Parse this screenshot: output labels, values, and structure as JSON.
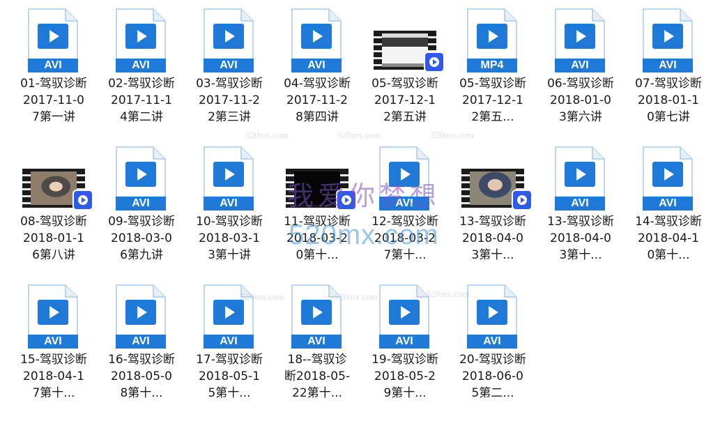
{
  "files": [
    {
      "name": "01-驾驭诊断2017-11-07第一讲",
      "type": "doc",
      "ext": "AVI"
    },
    {
      "name": "02-驾驭诊断2017-11-14第二讲",
      "type": "doc",
      "ext": "AVI"
    },
    {
      "name": "03-驾驭诊断2017-11-22第三讲",
      "type": "doc",
      "ext": "AVI"
    },
    {
      "name": "04-驾驭诊断2017-11-28第四讲",
      "type": "doc",
      "ext": "AVI"
    },
    {
      "name": "05-驾驭诊断2017-12-12第五讲",
      "type": "thumb",
      "thumb": "screen"
    },
    {
      "name": "05-驾驭诊断2017-12-12第五...",
      "type": "doc",
      "ext": "MP4"
    },
    {
      "name": "06-驾驭诊断2018-01-03第六讲",
      "type": "doc",
      "ext": "AVI"
    },
    {
      "name": "07-驾驭诊断2018-01-10第七讲",
      "type": "doc",
      "ext": "AVI"
    },
    {
      "name": "08-驾驭诊断2018-01-16第八讲",
      "type": "thumb",
      "thumb": "person"
    },
    {
      "name": "09-驾驭诊断2018-03-06第九讲",
      "type": "doc",
      "ext": "AVI"
    },
    {
      "name": "10-驾驭诊断2018-03-13第十讲",
      "type": "doc",
      "ext": "AVI"
    },
    {
      "name": "11-驾驭诊断2018-03-20第十...",
      "type": "thumb",
      "thumb": "dark"
    },
    {
      "name": "12-驾驭诊断2018-03-27第十...",
      "type": "doc",
      "ext": "AVI"
    },
    {
      "name": "13-驾驭诊断2018-04-03第十...",
      "type": "thumb",
      "thumb": "person2"
    },
    {
      "name": "13-驾驭诊断2018-04-03第十...",
      "type": "doc",
      "ext": "AVI"
    },
    {
      "name": "14-驾驭诊断2018-04-10第十...",
      "type": "doc",
      "ext": "AVI"
    },
    {
      "name": "15-驾驭诊断2018-04-17第十...",
      "type": "doc",
      "ext": "AVI"
    },
    {
      "name": "16-驾驭诊断2018-05-08第十...",
      "type": "doc",
      "ext": "AVI"
    },
    {
      "name": "17-驾驭诊断2018-05-15第十...",
      "type": "doc",
      "ext": "AVI"
    },
    {
      "name": "18--驾驭诊断2018-05-22第十...",
      "type": "doc",
      "ext": "AVI"
    },
    {
      "name": "19-驾驭诊断2018-05-29第十...",
      "type": "doc",
      "ext": "AVI"
    },
    {
      "name": "20-驾驭诊断2018-06-05第二...",
      "type": "doc",
      "ext": "AVI"
    }
  ],
  "watermark": {
    "cn": "我爱你梦想",
    "en": "520mx.com",
    "small": "520mx.com"
  },
  "colors": {
    "accent": "#1e7ad6",
    "badge": "#2f5be6"
  },
  "icons": {
    "doc": "video-file-icon",
    "thumb": "video-thumbnail-icon",
    "badge": "play-badge-icon"
  }
}
